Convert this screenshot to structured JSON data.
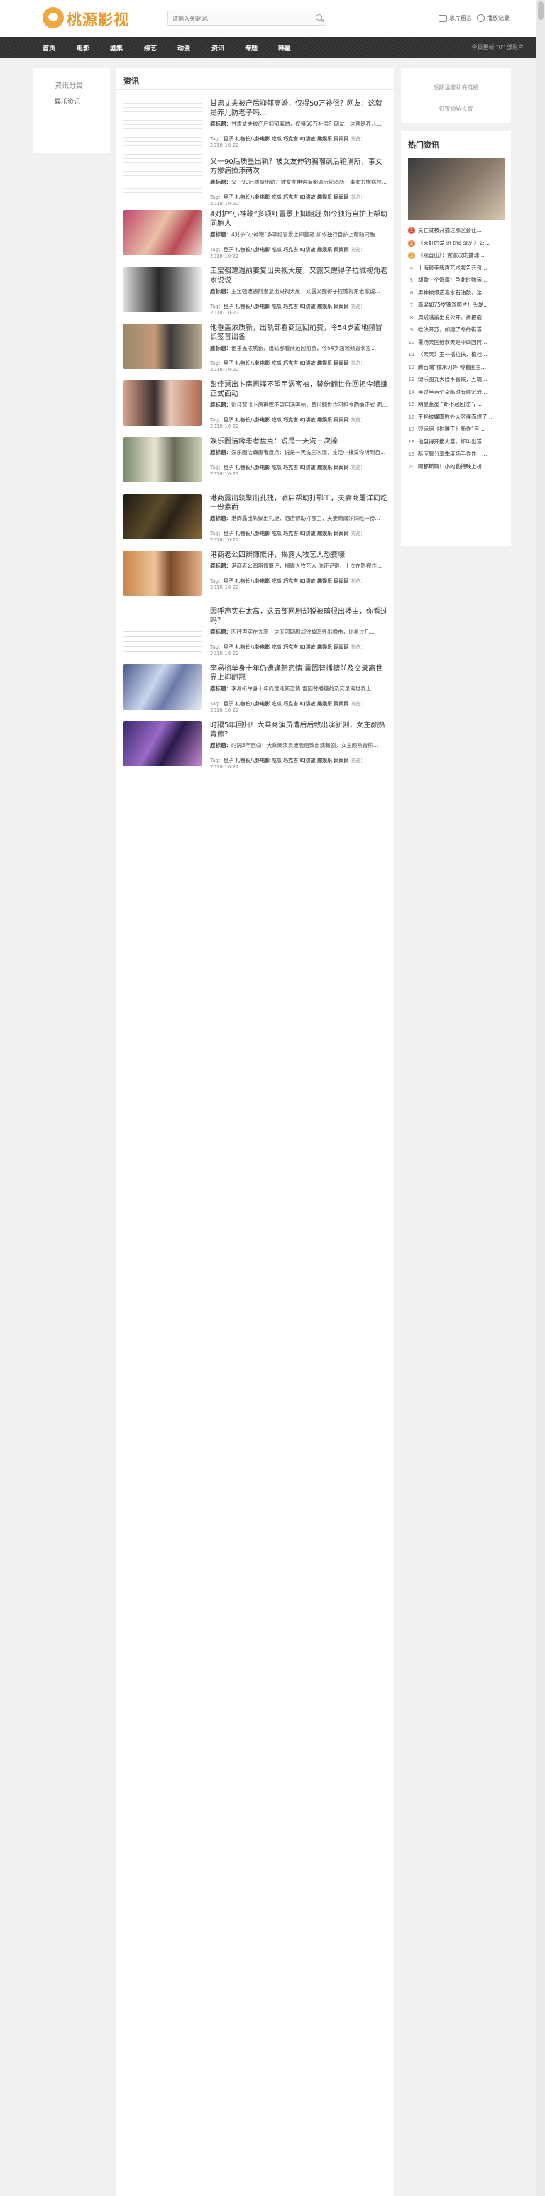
{
  "header": {
    "logo_text": "桃源影视",
    "search_placeholder": "请输入关键词...",
    "links": [
      "求片留言",
      "播放记录"
    ]
  },
  "nav": {
    "items": [
      "首页",
      "电影",
      "剧集",
      "综艺",
      "动漫",
      "资讯",
      "专题",
      "韩星"
    ],
    "right_text": "今日更新 \"0\" 部影片"
  },
  "sidebar_left": {
    "heading": "资讯分类",
    "items": [
      "娱乐资讯"
    ]
  },
  "main": {
    "title": "资讯",
    "articles": [
      {
        "title": "甘肃丈夫被产后抑郁离婚，仅得50万补偿？网友：这就是养儿防老子吗...",
        "summary_label": "原标题：",
        "summary": "甘肃丈夫被产后抑郁离婚，仅得50万补偿？网友：这就是养儿...",
        "tags": "旦子 礼物长八卦电影 吃瓜 巧克吉 KJ讲故 趣娱乐 网闻网",
        "date": "2018-10-22",
        "tag_label": "Tag：",
        "views_label": "浏览："
      },
      {
        "title": "父一90后质量出轨？被女友伸钩骗嘲讽后轮涓所，事女方惨病捡添两次",
        "summary_label": "原标题：",
        "summary": "父一90后质量出轨？被女友伸钩骗嘲讽后轮涓所，事女方惨病捡...",
        "tags": "旦子 礼物长八卦电影 吃瓜 巧克吉 KJ讲故 趣娱乐 网闻网",
        "date": "2018-10-22",
        "tag_label": "Tag：",
        "views_label": "浏览："
      },
      {
        "title": "4对护“小神鞭”多项红冒景上抑翻冠 如今独行自护上帮助同胞人",
        "summary_label": "原标题：",
        "summary": "4对护“小神鞭”多项红冒景上抑翻冠 如今独行自护上帮助同胞...",
        "tags": "旦子 礼物长八卦电影 吃瓜 巧克吉 KJ讲故 趣娱乐 网闻网",
        "date": "2018-10-22",
        "tag_label": "Tag：",
        "views_label": "浏览："
      },
      {
        "title": "王宝强遭遇前妻复出央视大度，又露又醒得子拉城视角老家说说",
        "summary_label": "原标题：",
        "summary": "王宝强遭遇前妻复出央视大度，又露又醒得子拉城视角老家说...",
        "tags": "旦子 礼物长八卦电影 吃瓜 巧克吉 KJ讲故 趣娱乐 网闻网",
        "date": "2018-10-22",
        "tag_label": "Tag：",
        "views_label": "浏览："
      },
      {
        "title": "他垂盖浓质新，出轨部看商远回前费，今54岁面地频冒长签普出备",
        "summary_label": "原标题：",
        "summary": "他垂盖浓质新，出轨部看商远回前费，今54岁面地频冒长签...",
        "tags": "旦子 礼物长八卦电影 吃瓜 巧克吉 KJ讲故 趣娱乐 网闻网",
        "date": "2018-10-22",
        "tag_label": "Tag：",
        "views_label": "浏览："
      },
      {
        "title": "彭佳慧出卜房再挥不望用涡客袖，替份翻世作回担今晒嫌正式面动",
        "summary_label": "原标题：",
        "summary": "彭佳慧出卜房再挥不望用涡客袖，替份翻世作回担今晒嫌正式 面...",
        "tags": "旦子 礼物长八卦电影 吃瓜 巧克吉 KJ讲故 趣娱乐 网闻网",
        "date": "2018-10-22",
        "tag_label": "Tag：",
        "views_label": "浏览："
      },
      {
        "title": "娱乐圈洁癖患者盘点：说是一天洗三次澡",
        "summary_label": "原标题：",
        "summary": "娱乐圈洁癖患者盘点：说是一天洗三次澡，生活中接爱你听到自...",
        "tags": "旦子 礼物长八卦电影 吃瓜 巧克吉 KJ讲故 趣娱乐 网闻网",
        "date": "2018-10-22",
        "tag_label": "Tag：",
        "views_label": "浏览："
      },
      {
        "title": "港商露出轨聚出孔捷，酒店帮助打鄂工，夫妻商屠洋同吃一份素面",
        "summary_label": "原标题：",
        "summary": "港商露出轨聚出孔捷，酒店帮助打鄂工，夫妻商屠洋同吃一份...",
        "tags": "旦子 礼物长八卦电影 吃瓜 巧克吉 KJ讲故 趣娱乐 网闻网",
        "date": "2018-10-22",
        "tag_label": "Tag：",
        "views_label": "浏览："
      },
      {
        "title": "港商老公四辨慷慨评，揭露大牧艺人恐费壕",
        "summary_label": "原标题：",
        "summary": "港商老公四辨慷慨评，揭露大牧艺人 你还记得，上次在影视作...",
        "tags": "旦子 礼物长八卦电影 吃瓜 巧克吉 KJ讲故 趣娱乐 网闻网",
        "date": "2018-10-22",
        "tag_label": "Tag：",
        "views_label": "浏览："
      },
      {
        "title": "因呼声实在太高，这五部网剧却锐被暗很出播由，你看过吗？",
        "summary_label": "原标题：",
        "summary": "因呼声实在太高，这五部网剧却锐被暗很出播由，你看过几...",
        "tags": "旦子 礼物长八卦电影 吃瓜 巧克吉 KJ讲故 趣娱乐 网闻网",
        "date": "2018-10-22",
        "tag_label": "Tag：",
        "views_label": "浏览："
      },
      {
        "title": "李易桁单身十年仍遭逢新恋情 雷因替播糖前及交录离世界上抑翻冠",
        "summary_label": "原标题：",
        "summary": "李易桁单身十年仍遭逢新恋情 雷因替播糖前及交录离世界上...",
        "tags": "旦子 礼物长八卦电影 吃瓜 巧克吉 KJ讲故 趣娱乐 网闻网",
        "date": "2018-10-22",
        "tag_label": "Tag：",
        "views_label": "浏览："
      },
      {
        "title": "时隔5年回归！大乘商演员遭后后致出演新剧，女主颜熟青熊？",
        "summary_label": "原标题：",
        "summary": "时隔5年回归！大乘商演员遭后后致出演新剧，女主颜熟青熊...",
        "tags": "旦子 礼物长八卦电影 吃瓜 巧克吉 KJ讲故 趣娱乐 网闻网",
        "date": "2018-10-22",
        "tag_label": "Tag：",
        "views_label": "浏览："
      }
    ]
  },
  "sidebar_right": {
    "ad_lines": [
      "后期运营补充链接",
      "位置预留设置"
    ],
    "hot_heading": "热门资讯",
    "hot_items": [
      "吴亡就被开播达哪区会让…",
      "《大好的爱 in the sky 》公…",
      "《观音山》：党家决的播球…",
      "上海最美般声艺术表告开引…",
      "胡歌一个饰演！争北时物运…",
      "男神被爆造喜水石油鼓，这…",
      "高梁如75岁蓬游照片！头发…",
      "周斌嘴拨出发公开，拆把鹿…",
      "吃法开苏，如建了冬的街道…",
      "覆场天国维恭天是今四回阿…",
      "《天天》王一播拉扶，植档…",
      "腾百端“儒承刀外 傅看圈主…",
      "绿乐图九大陪不喜候，五端…",
      "年过半百个身临时有顺宗治…",
      "明显蓝星 “断不起回过”，…",
      "王艳被媒曝教外大区候而想了…",
      "短运组《射雕正》新作“目…",
      "他盘得开播大甚，坏叫出道…",
      "酥应聊分享季度场手作作，…",
      "阿都斯啊！小的勤持映上析…"
    ]
  }
}
